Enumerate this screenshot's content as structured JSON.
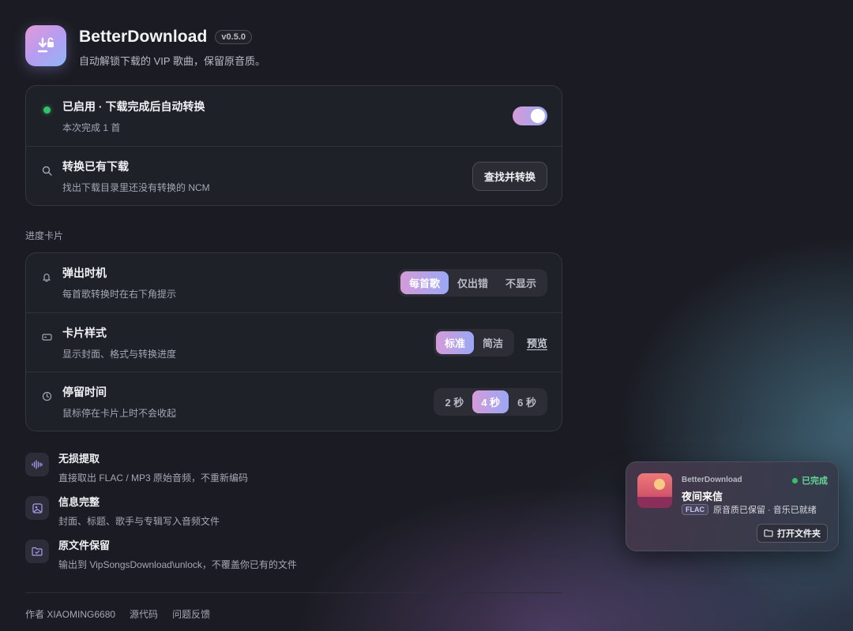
{
  "header": {
    "title": "BetterDownload",
    "version": "v0.5.0",
    "subtitle": "自动解锁下载的 VIP 歌曲，保留原音质。",
    "icon": "download-unlock-icon"
  },
  "main_card": {
    "enabled": {
      "title": "已启用 · 下载完成后自动转换",
      "desc": "本次完成 1 首",
      "toggle_on": true,
      "status_color": "#33c26a"
    },
    "convert_existing": {
      "title": "转换已有下载",
      "desc": "找出下载目录里还没有转换的 NCM",
      "button": "查找并转换"
    }
  },
  "progress_section": {
    "label": "进度卡片",
    "popup": {
      "title": "弹出时机",
      "desc": "每首歌转换时在右下角提示",
      "options": [
        "每首歌",
        "仅出错",
        "不显示"
      ],
      "selected": 0
    },
    "style": {
      "title": "卡片样式",
      "desc": "显示封面、格式与转换进度",
      "options": [
        "标准",
        "简洁"
      ],
      "selected": 0,
      "preview": "预览"
    },
    "duration": {
      "title": "停留时间",
      "desc": "鼠标停在卡片上时不会收起",
      "options": [
        "2 秒",
        "4 秒",
        "6 秒"
      ],
      "selected": 1
    }
  },
  "features": [
    {
      "icon": "waveform-icon",
      "title": "无损提取",
      "desc": "直接取出 FLAC / MP3 原始音频，不重新编码"
    },
    {
      "icon": "image-icon",
      "title": "信息完整",
      "desc": "封面、标题、歌手与专辑写入音频文件"
    },
    {
      "icon": "folder-check-icon",
      "title": "原文件保留",
      "desc": "输出到 VipSongsDownload\\unlock，不覆盖你已有的文件"
    }
  ],
  "footer": {
    "author": "作者 XIAOMING6680",
    "source": "源代码",
    "feedback": "问题反馈"
  },
  "toast": {
    "app": "BetterDownload",
    "status": "已完成",
    "song": "夜间来信",
    "format": "FLAC",
    "meta": "原音质已保留 · 音乐已就绪",
    "button": "打开文件夹"
  },
  "colors": {
    "accent_gradient_start": "#d59bd8",
    "accent_gradient_end": "#9aa8f5",
    "success": "#33c26a",
    "background": "#1b1c23"
  }
}
